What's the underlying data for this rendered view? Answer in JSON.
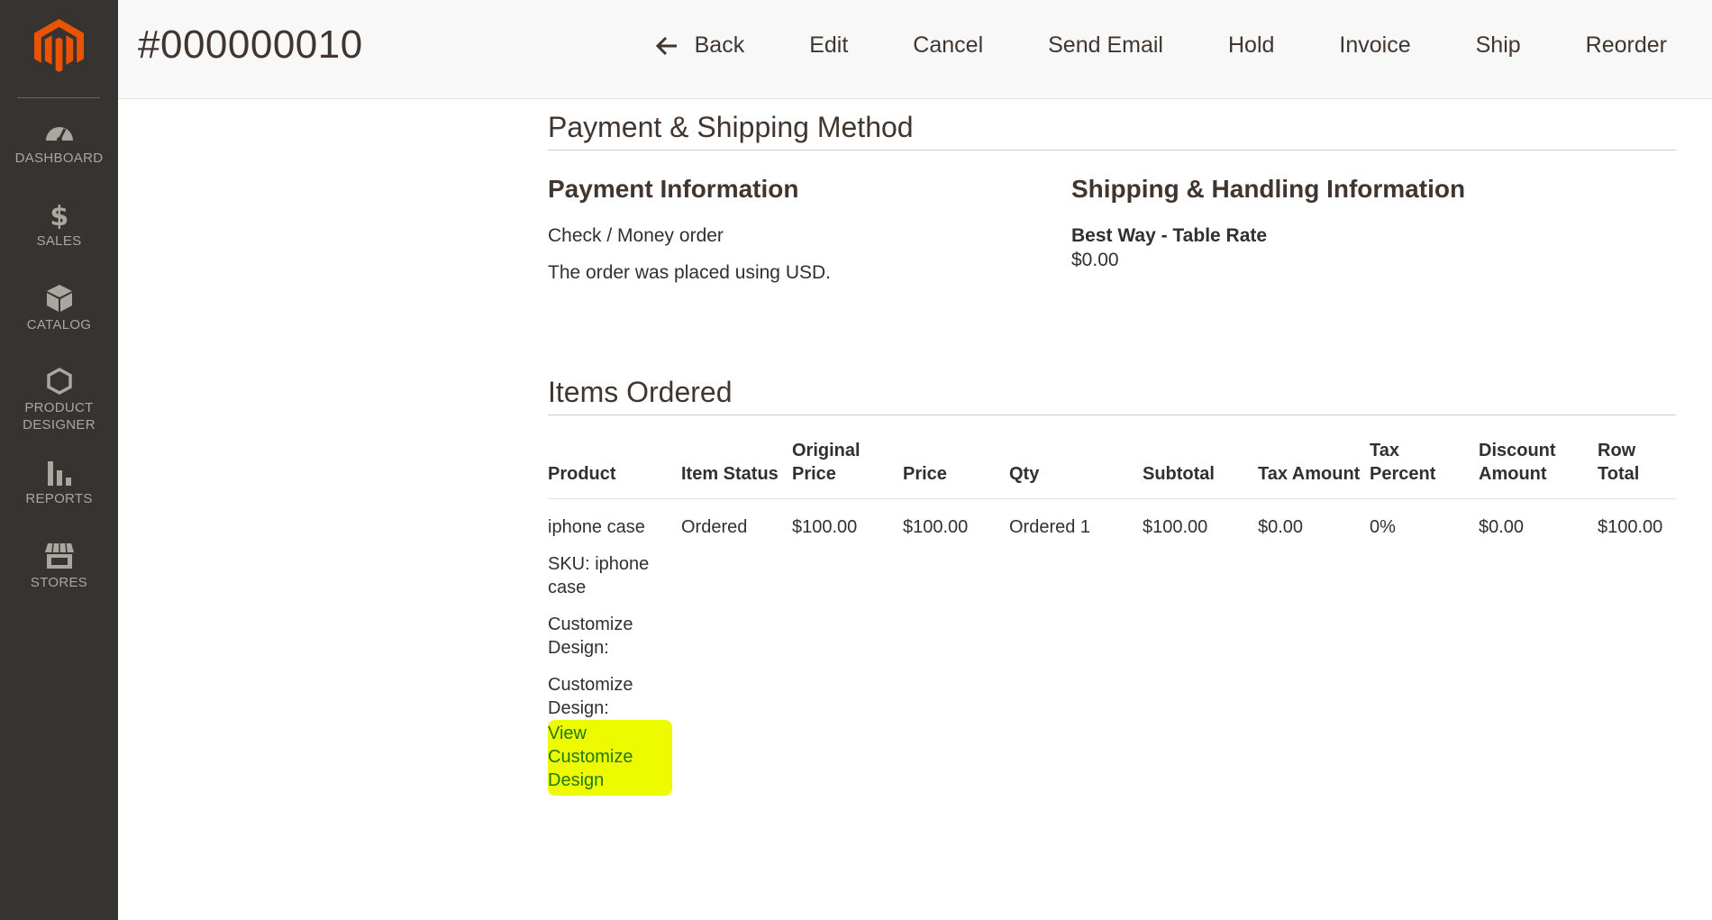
{
  "sidebar": {
    "items": [
      {
        "label": "DASHBOARD",
        "icon": "dashboard-icon"
      },
      {
        "label": "SALES",
        "icon": "dollar-icon"
      },
      {
        "label": "CATALOG",
        "icon": "box-icon"
      },
      {
        "label": "PRODUCT DESIGNER",
        "icon": "hexagon-icon"
      },
      {
        "label": "REPORTS",
        "icon": "bar-chart-icon"
      },
      {
        "label": "STORES",
        "icon": "store-icon"
      }
    ],
    "brand_color": "#eb5202"
  },
  "header": {
    "title": "#000000010",
    "actions": {
      "back": "Back",
      "edit": "Edit",
      "cancel": "Cancel",
      "send_email": "Send Email",
      "hold": "Hold",
      "invoice": "Invoice",
      "ship": "Ship",
      "reorder": "Reorder"
    }
  },
  "payment_shipping": {
    "section_title": "Payment & Shipping Method",
    "payment": {
      "title": "Payment Information",
      "method": "Check / Money order",
      "currency_note": "The order was placed using USD."
    },
    "shipping": {
      "title": "Shipping & Handling Information",
      "method": "Best Way - Table Rate",
      "amount": "$0.00"
    }
  },
  "items_ordered": {
    "section_title": "Items Ordered",
    "columns": {
      "product": "Product",
      "item_status": "Item Status",
      "original_price": "Original Price",
      "price": "Price",
      "qty": "Qty",
      "subtotal": "Subtotal",
      "tax_amount": "Tax Amount",
      "tax_percent": "Tax Percent",
      "discount_amount": "Discount Amount",
      "row_total": "Row Total"
    },
    "rows": [
      {
        "product_name": "iphone case",
        "sku": "SKU: iphone case",
        "option_label_1": "Customize Design:",
        "option_label_2": "Customize Design:",
        "design_link": "View Customize Design",
        "item_status": "Ordered",
        "original_price": "$100.00",
        "price": "$100.00",
        "qty": "Ordered 1",
        "subtotal": "$100.00",
        "tax_amount": "$0.00",
        "tax_percent": "0%",
        "discount_amount": "$0.00",
        "row_total": "$100.00"
      }
    ]
  }
}
